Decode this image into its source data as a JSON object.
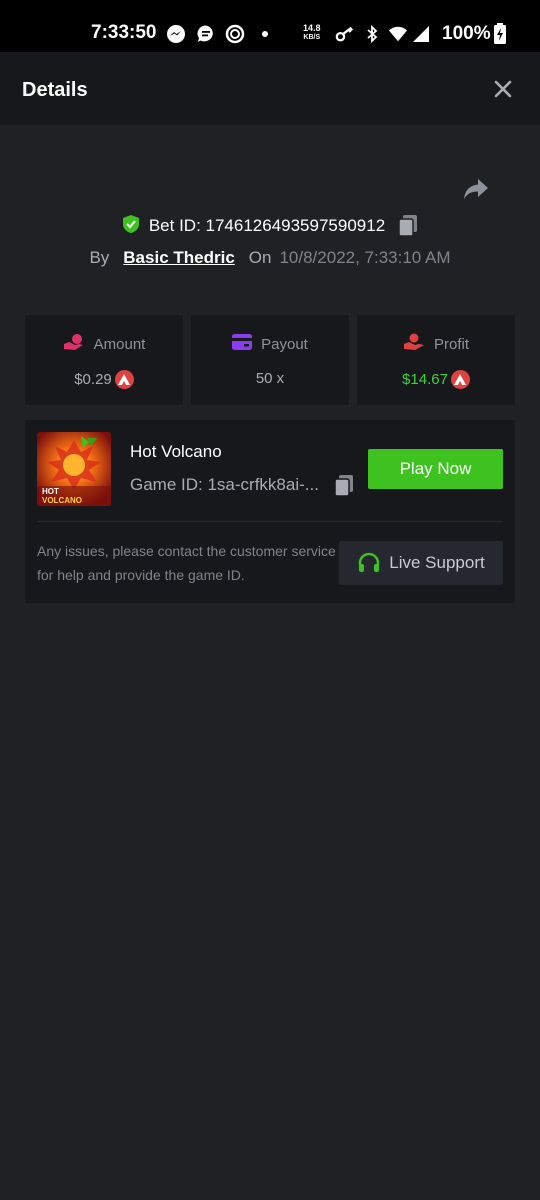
{
  "status_bar": {
    "time": "7:33:50",
    "net_speed_value": "14.8",
    "net_speed_unit": "KB/S",
    "battery_percent": "100%"
  },
  "header": {
    "title": "Details"
  },
  "bet": {
    "bet_id": "Bet ID: 1746126493597590912",
    "by_label": "By",
    "username": "Basic Thedric",
    "on_label": "On",
    "date": "10/8/2022, 7:33:10 AM"
  },
  "stats": [
    {
      "label": "Amount",
      "value": "$0.29",
      "icon": "money-hand-icon",
      "color": "#e0306a"
    },
    {
      "label": "Payout",
      "value": "50 x",
      "icon": "card-icon",
      "color": "#8a3cf0"
    },
    {
      "label": "Profit",
      "value": "$14.67",
      "icon": "profit-hand-icon",
      "color": "#e2403f"
    }
  ],
  "game": {
    "name": "Hot Volcano",
    "game_id": "Game ID: 1sa-crfkk8ai-...",
    "thumbnail_text_line1": "HOT",
    "thumbnail_text_line2": "VOLCANO",
    "play_label": "Play Now",
    "issue_text": "Any issues, please contact the customer service for help and provide the game ID.",
    "support_label": "Live Support"
  },
  "colors": {
    "background": "#202124",
    "panel": "#17181b",
    "accent_green": "#3dc21f",
    "profit_green": "#3fd13c",
    "coin_red": "#e2403f"
  }
}
